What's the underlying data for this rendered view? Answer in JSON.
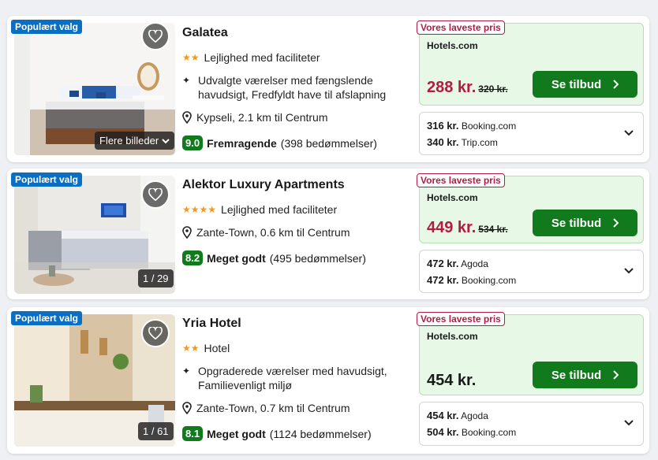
{
  "common": {
    "popular_label": "Populært valg",
    "lowest_label": "Vores laveste pris",
    "deal_label": "Se tilbud",
    "more_images": "Flere billeder"
  },
  "hotels": [
    {
      "name": "Galatea",
      "stars": "★★",
      "type": "Lejlighed med faciliteter",
      "amenity": "Udvalgte værelser med fængslende havudsigt, Fredfyldt have til afslapning",
      "location": "Kypseli, 2.1 km til Centrum",
      "score": "9.0",
      "rating_word": "Fremragende",
      "reviews": "(398 bedømmelser)",
      "provider": "Hotels.com",
      "price": "288 kr.",
      "old_price": "320 kr.",
      "others": [
        {
          "price": "316 kr.",
          "provider": "Booking.com"
        },
        {
          "price": "340 kr.",
          "provider": "Trip.com"
        }
      ]
    },
    {
      "name": "Alektor Luxury Apartments",
      "stars": "★★★★",
      "type": "Lejlighed med faciliteter",
      "location": "Zante-Town, 0.6 km til Centrum",
      "score": "8.2",
      "rating_word": "Meget godt",
      "reviews": "(495 bedømmelser)",
      "image_counter": "1 / 29",
      "provider": "Hotels.com",
      "price": "449 kr.",
      "old_price": "534 kr.",
      "others": [
        {
          "price": "472 kr.",
          "provider": "Agoda"
        },
        {
          "price": "472 kr.",
          "provider": "Booking.com"
        }
      ]
    },
    {
      "name": "Yria Hotel",
      "stars": "★★",
      "type": "Hotel",
      "amenity": "Opgraderede værelser med havudsigt, Familievenligt miljø",
      "location": "Zante-Town, 0.7 km til Centrum",
      "score": "8.1",
      "rating_word": "Meget godt",
      "reviews": "(1124 bedømmelser)",
      "image_counter": "1 / 61",
      "provider": "Hotels.com",
      "price": "454 kr.",
      "others": [
        {
          "price": "454 kr.",
          "provider": "Agoda"
        },
        {
          "price": "504 kr.",
          "provider": "Booking.com"
        }
      ]
    }
  ],
  "colors": {
    "brand_blue": "#0a6fc2",
    "deal_green": "#117a1c",
    "offer_bg": "#e7f8e6",
    "price_red": "#b01c44",
    "star_orange": "#f39a1c"
  }
}
